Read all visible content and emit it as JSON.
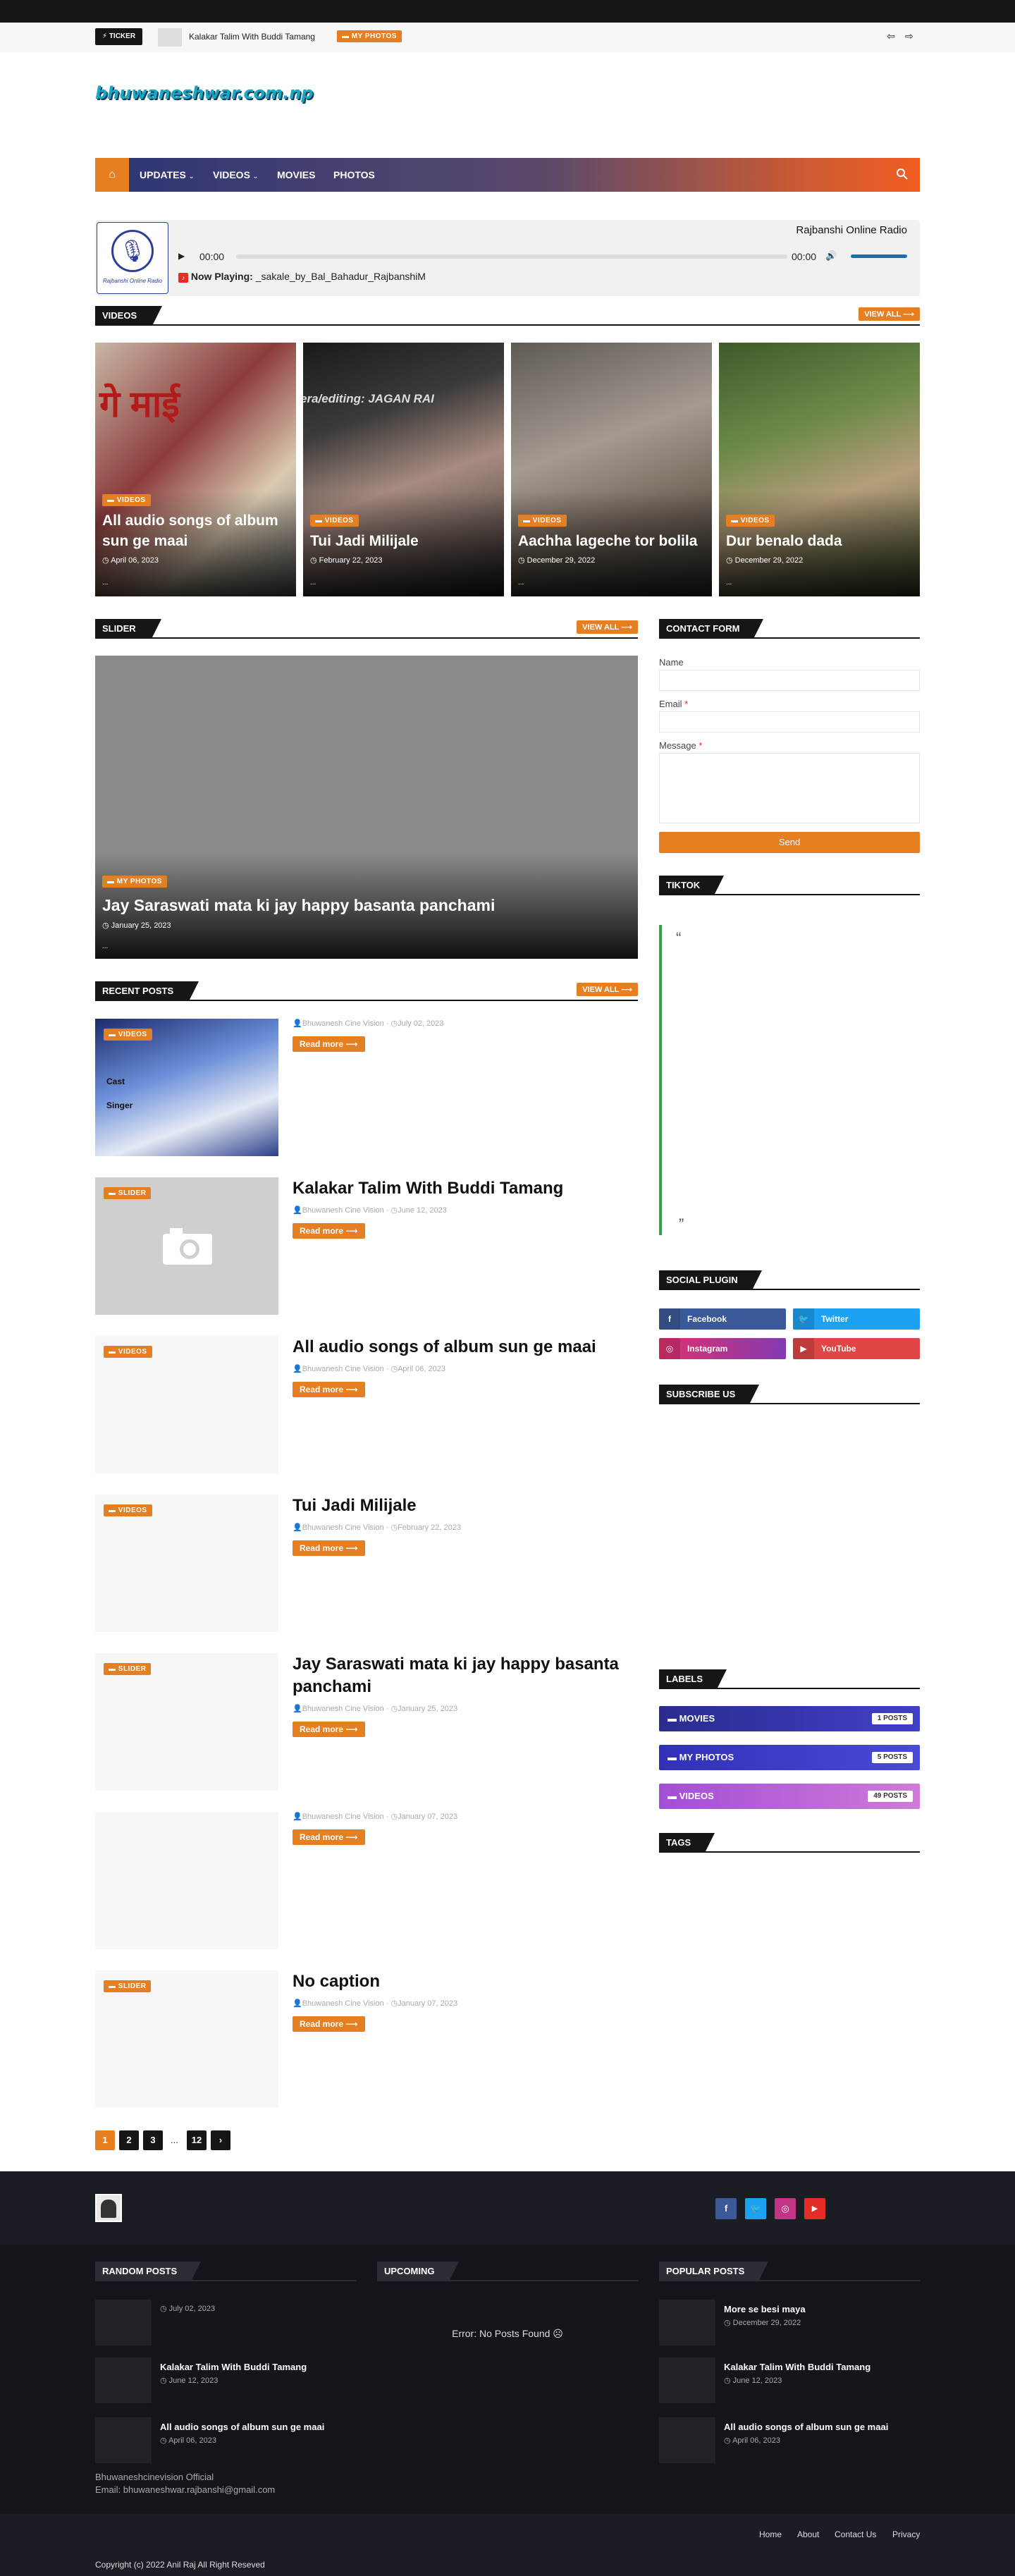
{
  "ticker": {
    "label": "TICKER",
    "headline": "Kalakar Talim With Buddi Tamang",
    "tag": "MY PHOTOS"
  },
  "site": {
    "logo_text": "bhuwaneshwar.com.np"
  },
  "nav": {
    "items": [
      {
        "label": "UPDATES",
        "has_dropdown": true
      },
      {
        "label": "VIDEOS",
        "has_dropdown": true
      },
      {
        "label": "MOVIES",
        "has_dropdown": false
      },
      {
        "label": "PHOTOS",
        "has_dropdown": false
      }
    ],
    "home_icon": "home-icon",
    "search_icon": "search-icon"
  },
  "radio": {
    "station_name": "Rajbanshi Online Radio",
    "logo_text": "Rajbanshi Online Radio",
    "time_current": "00:00",
    "time_total": "00:00",
    "now_playing_label": "Now Playing:",
    "now_playing_track": "_sakale_by_Bal_Bahadur_RajbanshiM"
  },
  "videos_section": {
    "title": "VIDEOS",
    "view_all": "VIEW ALL ⟶",
    "cards": [
      {
        "tag": "VIDEOS",
        "title": "All audio songs of album sun ge maai",
        "date": "April 06, 2023",
        "footer": "..."
      },
      {
        "tag": "VIDEOS",
        "title": "Tui Jadi Milijale",
        "date": "February 22, 2023",
        "footer": "..."
      },
      {
        "tag": "VIDEOS",
        "title": "Aachha lageche tor bolila",
        "date": "December 29, 2022",
        "footer": "..."
      },
      {
        "tag": "VIDEOS",
        "title": "Dur benalo dada",
        "date": "December 29, 2022",
        "footer": "..."
      }
    ],
    "overlay_text_2": "era/editing: JAGAN RAI",
    "overlay_text_1": "गे माई"
  },
  "slider_section": {
    "title": "SLIDER",
    "view_all": "VIEW ALL ⟶",
    "tag": "MY PHOTOS",
    "headline": "Jay Saraswati mata ki jay happy basanta panchami",
    "date": "January 25, 2023",
    "footer": "..."
  },
  "recent_posts": {
    "title": "RECENT POSTS",
    "view_all": "VIEW ALL ⟶",
    "read_more": "Read more ⟶",
    "posts": [
      {
        "tag": "VIDEOS",
        "title": "",
        "author": "Bhuwanesh Cine Vision",
        "date": "July 02, 2023",
        "thumb_cast": "Cast",
        "thumb_singer": "Singer"
      },
      {
        "tag": "SLIDER",
        "title": "Kalakar Talim With Buddi Tamang",
        "author": "Bhuwanesh Cine Vision",
        "date": "June 12, 2023"
      },
      {
        "tag": "VIDEOS",
        "title": "All audio songs of album sun ge maai",
        "author": "Bhuwanesh Cine Vision",
        "date": "April 06, 2023"
      },
      {
        "tag": "VIDEOS",
        "title": "Tui Jadi Milijale",
        "author": "Bhuwanesh Cine Vision",
        "date": "February 22, 2023"
      },
      {
        "tag": "SLIDER",
        "title": "Jay Saraswati mata ki jay happy basanta panchami",
        "author": "Bhuwanesh Cine Vision",
        "date": "January 25, 2023"
      },
      {
        "tag": "",
        "title": "",
        "author": "Bhuwanesh Cine Vision",
        "date": "January 07, 2023"
      },
      {
        "tag": "SLIDER",
        "title": "No caption",
        "author": "Bhuwanesh Cine Vision",
        "date": "January 07, 2023"
      }
    ]
  },
  "pagination": {
    "pages": [
      "1",
      "2",
      "3"
    ],
    "ellipsis": "...",
    "last": "12",
    "next": "›"
  },
  "contact_form": {
    "title": "CONTACT FORM",
    "name_label": "Name",
    "email_label": "Email",
    "message_label": "Message",
    "required_mark": "*",
    "send_label": "Send"
  },
  "tiktok": {
    "title": "TIKTOK",
    "open_quote": "“",
    "close_quote": "”"
  },
  "social_plugin": {
    "title": "SOCIAL PLUGIN",
    "items": [
      {
        "label": "Facebook",
        "color": "#3b5998"
      },
      {
        "label": "Twitter",
        "color": "#1da1f2"
      },
      {
        "label": "Instagram",
        "color": "#c13584"
      },
      {
        "label": "YouTube",
        "color": "#e52d27"
      }
    ]
  },
  "subscribe": {
    "title": "SUBSCRIBE US"
  },
  "labels": {
    "title": "LABELS",
    "items": [
      {
        "name": "MOVIES",
        "count": "1 POSTS",
        "color": "#3d3db3"
      },
      {
        "name": "MY PHOTOS",
        "count": "5 POSTS",
        "color": "#3a3ad0"
      },
      {
        "name": "VIDEOS",
        "count": "49 POSTS",
        "color": "#b45fd6"
      }
    ]
  },
  "tags": {
    "title": "TAGS"
  },
  "footer": {
    "random_posts": {
      "title": "RANDOM POSTS",
      "items": [
        {
          "title": "",
          "date": "July 02, 2023"
        },
        {
          "title": "Kalakar Talim With Buddi Tamang",
          "date": "June 12, 2023"
        },
        {
          "title": "All audio songs of album sun ge maai",
          "date": "April 06, 2023"
        }
      ]
    },
    "upcoming": {
      "title": "UPCOMING",
      "error": "Error: No Posts Found ☹"
    },
    "popular_posts": {
      "title": "POPULAR POSTS",
      "items": [
        {
          "title": "More se besi maya",
          "date": "December 29, 2022"
        },
        {
          "title": "Kalakar Talim With Buddi Tamang",
          "date": "June 12, 2023"
        },
        {
          "title": "All audio songs of album sun ge maai",
          "date": "April 06, 2023"
        }
      ]
    },
    "about_line_1": "Bhuwaneshcinevision Official",
    "about_line_2": "Email: bhuwaneshwar.rajbanshi@gmail.com",
    "links": [
      "Home",
      "About",
      "Contact Us",
      "Privacy"
    ],
    "copyright": "Copyright (c) 2022 Anil Raj All Right Reseved"
  },
  "colors": {
    "accent": "#e67e22",
    "dark": "#161619",
    "footer_bg": "#1b1d24",
    "footer_bottom": "#14151a"
  }
}
